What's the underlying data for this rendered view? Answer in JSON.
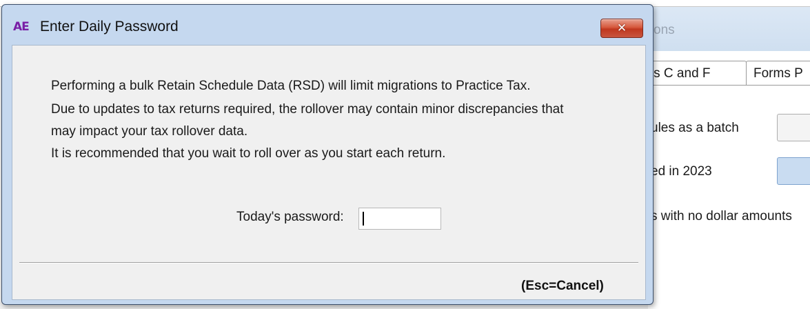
{
  "dialog": {
    "app_icon": "AE",
    "title": "Enter Daily Password",
    "close_icon": "close-x-icon",
    "close_glyph": "✕",
    "message_lines": [
      "Performing a bulk Retain Schedule Data (RSD) will limit migrations to Practice Tax.",
      "Due to updates to tax returns required, the rollover may contain minor discrepancies that",
      "may impact your tax rollover data.",
      "It is recommended that you wait to roll over as you start each return."
    ],
    "password_label": "Today's password:",
    "password_value": "",
    "cancel_label": "(Esc=Cancel)"
  },
  "background": {
    "title_fragment": "ons",
    "tabs": [
      "rms C and F",
      "Forms P"
    ],
    "option_lines": [
      "ules as a batch",
      "ed in 2023",
      "s with no dollar amounts"
    ]
  },
  "colors": {
    "dialog_frame": "#c5d8ef",
    "close_button": "#c8553f",
    "app_icon": "#7a1fa6"
  }
}
